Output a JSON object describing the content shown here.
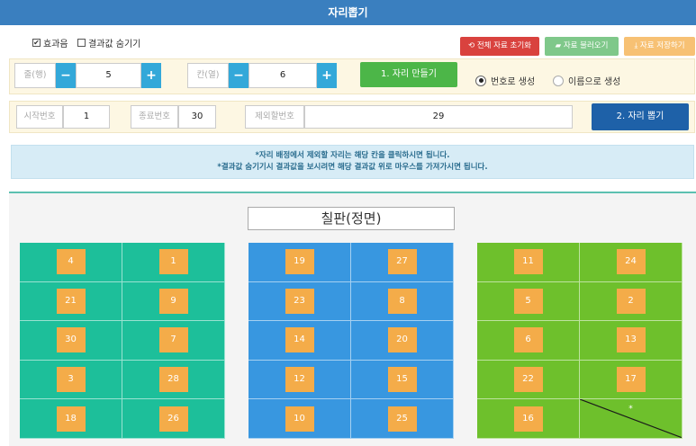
{
  "header": {
    "title": "자리뽑기"
  },
  "options": {
    "sound_label": "효과음",
    "hide_label": "결과값 숨기기"
  },
  "actions": {
    "reset": "전체 자료 초기화",
    "load": "자료 불러오기",
    "save": "자료 저장하기"
  },
  "setup": {
    "rows_label": "줄(행)",
    "rows_value": "5",
    "cols_label": "칸(열)",
    "cols_value": "6",
    "make_button": "1. 자리 만들기",
    "gen_by_number": "번호로 생성",
    "gen_by_name": "이름으로 생성"
  },
  "range": {
    "start_label": "시작번호",
    "start_value": "1",
    "end_label": "종료번호",
    "end_value": "30",
    "exclude_label": "제외할번호",
    "exclude_value": "29",
    "pick_button": "2. 자리 뽑기"
  },
  "notice": {
    "line1": "*자리 배정에서 제외할 자리는 해당 칸을 클릭하시면 됩니다.",
    "line2": "*결과값 숨기기시 결과값을 보시려면 해당 결과값 위로 마우스를 가져가시면 됩니다."
  },
  "board": {
    "label": "칠판(정면)"
  },
  "seats": {
    "rows": [
      [
        "4",
        "1",
        "19",
        "27",
        "11",
        "24"
      ],
      [
        "21",
        "9",
        "23",
        "8",
        "5",
        "2"
      ],
      [
        "30",
        "7",
        "14",
        "20",
        "6",
        "13"
      ],
      [
        "3",
        "28",
        "12",
        "15",
        "22",
        "17"
      ],
      [
        "18",
        "26",
        "10",
        "25",
        "16",
        "*"
      ]
    ],
    "excluded_mark": "*"
  },
  "colors": {
    "title_bar": "#3a7fbf",
    "group1": "#1dbf9a",
    "group2": "#3897e0",
    "group3": "#6ec02c",
    "seat": "#f4ac49",
    "reset": "#d9423e",
    "load": "#7fc88a",
    "save": "#f7c174"
  }
}
